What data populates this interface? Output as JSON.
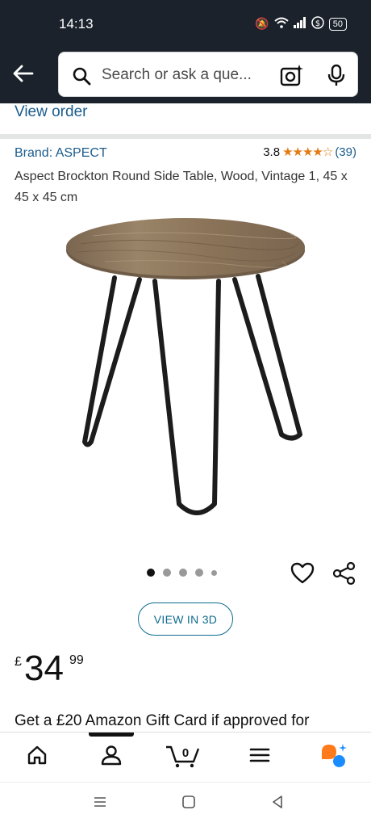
{
  "status_bar": {
    "time": "14:13",
    "battery": "50"
  },
  "search": {
    "placeholder": "Search or ask a que..."
  },
  "view_order": "View order",
  "product": {
    "brand": "Brand: ASPECT",
    "rating_value": "3.8",
    "rating_stars": 3.8,
    "rating_count": "(39)",
    "title": "Aspect Brockton Round Side Table, Wood, Vintage 1, 45 x 45 x 45 cm",
    "image_count": 5,
    "image_active_index": 0
  },
  "view_3d_label": "VIEW IN 3D",
  "price": {
    "currency": "£",
    "whole": "34",
    "fraction": "99"
  },
  "promo": "Get a £20 Amazon Gift Card if approved for",
  "bottom_nav": {
    "items": [
      "home-icon",
      "account-icon",
      "cart-icon",
      "menu-icon",
      "rufus-icon"
    ],
    "cart_count": "0"
  },
  "colors": {
    "header": "#1b222b",
    "link": "#1b5c8c",
    "star": "#e47911",
    "teal": "#0f6b8f",
    "rufus_orange": "#ff7a1a",
    "rufus_blue": "#1a8cff"
  }
}
